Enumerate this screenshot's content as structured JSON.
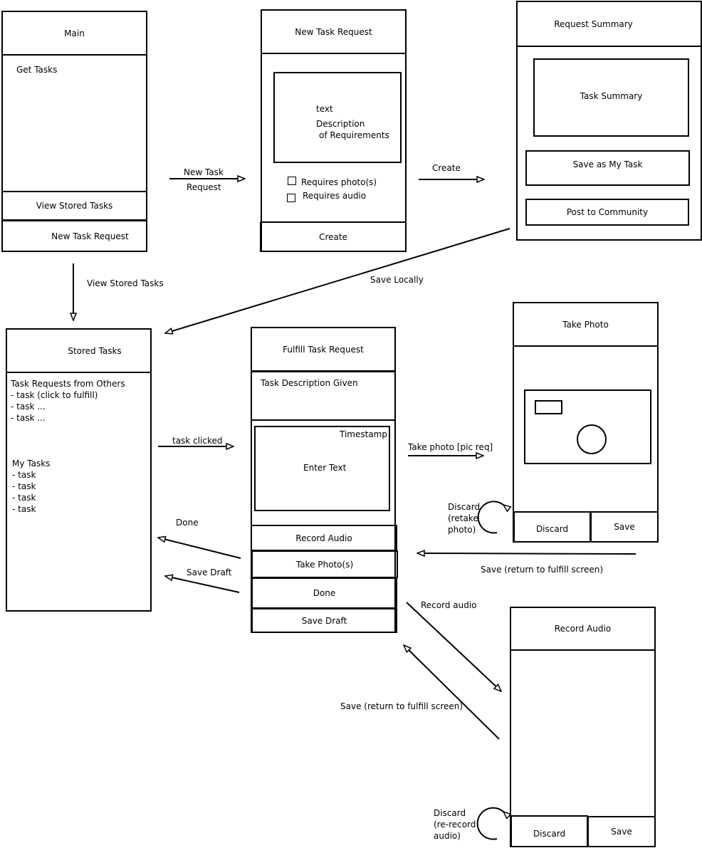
{
  "screens": {
    "main": {
      "title": "Main",
      "content": "Get Tasks",
      "buttons": [
        "View Stored Tasks",
        "New Task Request"
      ]
    },
    "new_task_request": {
      "title": "New Task Request",
      "textbox": [
        "text",
        "Description",
        "of Requirements"
      ],
      "checkboxes": [
        "Requires photo(s)",
        "Requires audio"
      ],
      "button": "Create"
    },
    "request_summary": {
      "title": "Request Summary",
      "summary": "Task Summary",
      "buttons": [
        "Save as My Task",
        "Post to Community"
      ]
    },
    "stored_tasks": {
      "title": "Stored Tasks",
      "others_heading": "Task Requests from Others",
      "others_items": [
        "- task (click to fulfill)",
        "- task ...",
        "- task ..."
      ],
      "my_heading": "My Tasks",
      "my_items": [
        "- task",
        "- task",
        "- task",
        "- task"
      ]
    },
    "fulfill": {
      "title": "Fulfill Task Request",
      "description": "Task Description Given",
      "timestamp": "Timestamp",
      "entry": "Enter Text",
      "buttons": [
        "Record Audio",
        "Take Photo(s)",
        "Done",
        "Save Draft"
      ]
    },
    "take_photo": {
      "title": "Take Photo",
      "buttons": [
        "Discard",
        "Save"
      ]
    },
    "record_audio": {
      "title": "Record Audio",
      "buttons": [
        "Discard",
        "Save"
      ]
    }
  },
  "arrows": {
    "new_task": [
      "New Task",
      "Request"
    ],
    "create": "Create",
    "save_locally": "Save Locally",
    "view_stored": "View Stored Tasks",
    "task_clicked": "task clicked",
    "take_photo": "Take photo [pic req]",
    "done": "Done",
    "save_draft": "Save Draft",
    "photo_save": "Save (return to fulfill screen)",
    "record_audio": "Record audio",
    "audio_save": "Save (return to fulfill screen)",
    "photo_discard": [
      "Discard",
      "(retake",
      "photo)"
    ],
    "audio_discard": [
      "Discard",
      "(re-record",
      "audio)"
    ]
  }
}
